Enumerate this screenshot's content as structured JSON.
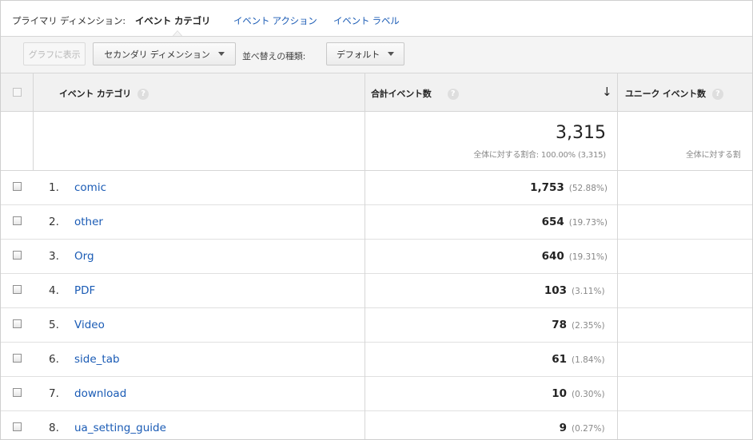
{
  "dimension_bar": {
    "label": "プライマリ ディメンション:",
    "active": "イベント カテゴリ",
    "options": [
      "イベント アクション",
      "イベント ラベル"
    ]
  },
  "toolbar": {
    "chart_button": "グラフに表示",
    "secondary_dimension": "セカンダリ ディメンション",
    "sort_label": "並べ替えの種類:",
    "sort_value": "デフォルト"
  },
  "table": {
    "headers": {
      "dimension": "イベント カテゴリ",
      "total_events": "合計イベント数",
      "unique_events": "ユニーク イベント数",
      "help": "?",
      "sort_arrow": "↓"
    },
    "totals": {
      "value": "3,315",
      "percent_label": "全体に対する割合: 100.00% (3,315)",
      "unique_partial": "全体に対する割"
    },
    "rows": [
      {
        "num": "1.",
        "name": "comic",
        "value": "1,753",
        "pct": "(52.88%)"
      },
      {
        "num": "2.",
        "name": "other",
        "value": "654",
        "pct": "(19.73%)"
      },
      {
        "num": "3.",
        "name": "Org",
        "value": "640",
        "pct": "(19.31%)"
      },
      {
        "num": "4.",
        "name": "PDF",
        "value": "103",
        "pct": "(3.11%)"
      },
      {
        "num": "5.",
        "name": "Video",
        "value": "78",
        "pct": "(2.35%)"
      },
      {
        "num": "6.",
        "name": "side_tab",
        "value": "61",
        "pct": "(1.84%)"
      },
      {
        "num": "7.",
        "name": "download",
        "value": "10",
        "pct": "(0.30%)"
      },
      {
        "num": "8.",
        "name": "ua_setting_guide",
        "value": "9",
        "pct": "(0.27%)"
      }
    ]
  },
  "colors": {
    "link": "#1a5bb5",
    "header_bg": "#f1f1f1",
    "toolbar_bg": "#f4f4f4"
  }
}
